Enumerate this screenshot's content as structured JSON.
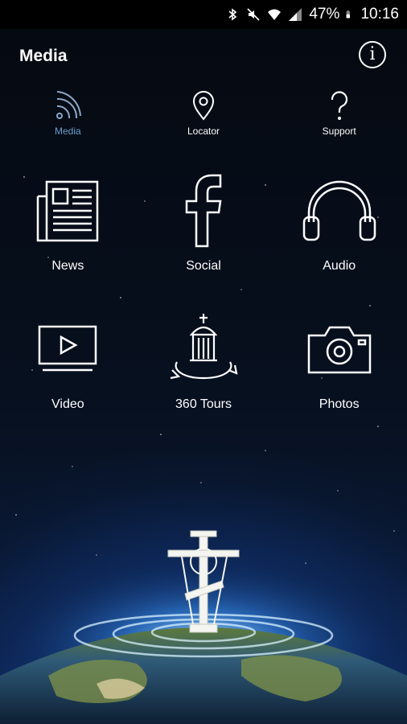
{
  "status_bar": {
    "battery": "47%",
    "time": "10:16"
  },
  "header": {
    "title": "Media",
    "info_icon": "info-icon"
  },
  "tabs": [
    {
      "label": "Media",
      "icon": "rss-icon",
      "active": true
    },
    {
      "label": "Locator",
      "icon": "location-pin-icon",
      "active": false
    },
    {
      "label": "Support",
      "icon": "question-icon",
      "active": false
    }
  ],
  "grid": [
    {
      "label": "News",
      "icon": "newspaper-icon"
    },
    {
      "label": "Social",
      "icon": "facebook-icon"
    },
    {
      "label": "Audio",
      "icon": "headphones-icon"
    },
    {
      "label": "Video",
      "icon": "video-play-icon"
    },
    {
      "label": "360 Tours",
      "icon": "rotating-chapel-icon"
    },
    {
      "label": "Photos",
      "icon": "camera-icon"
    }
  ],
  "colors": {
    "active_tab": "#6b9ecf",
    "background": "#060b16"
  }
}
